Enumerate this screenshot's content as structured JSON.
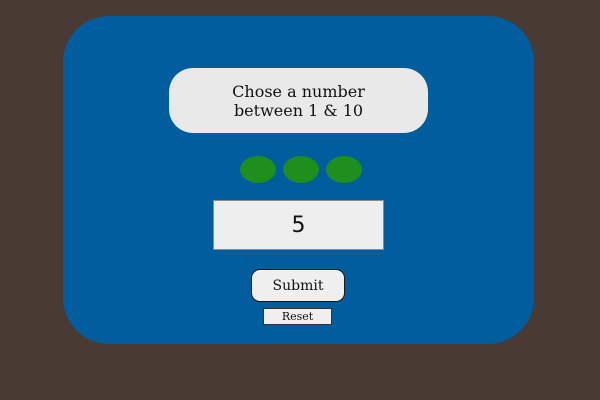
{
  "prompt": {
    "line1": "Chose a number",
    "line2": "between 1 & 10"
  },
  "attempts": {
    "remaining_count": 3,
    "color": "#1e8e1f"
  },
  "guess_input": {
    "value": "5"
  },
  "buttons": {
    "submit_label": "Submit",
    "reset_label": "Reset"
  },
  "colors": {
    "background": "#4a3a34",
    "card": "#015d9d",
    "bubble": "#e9e9e9"
  }
}
